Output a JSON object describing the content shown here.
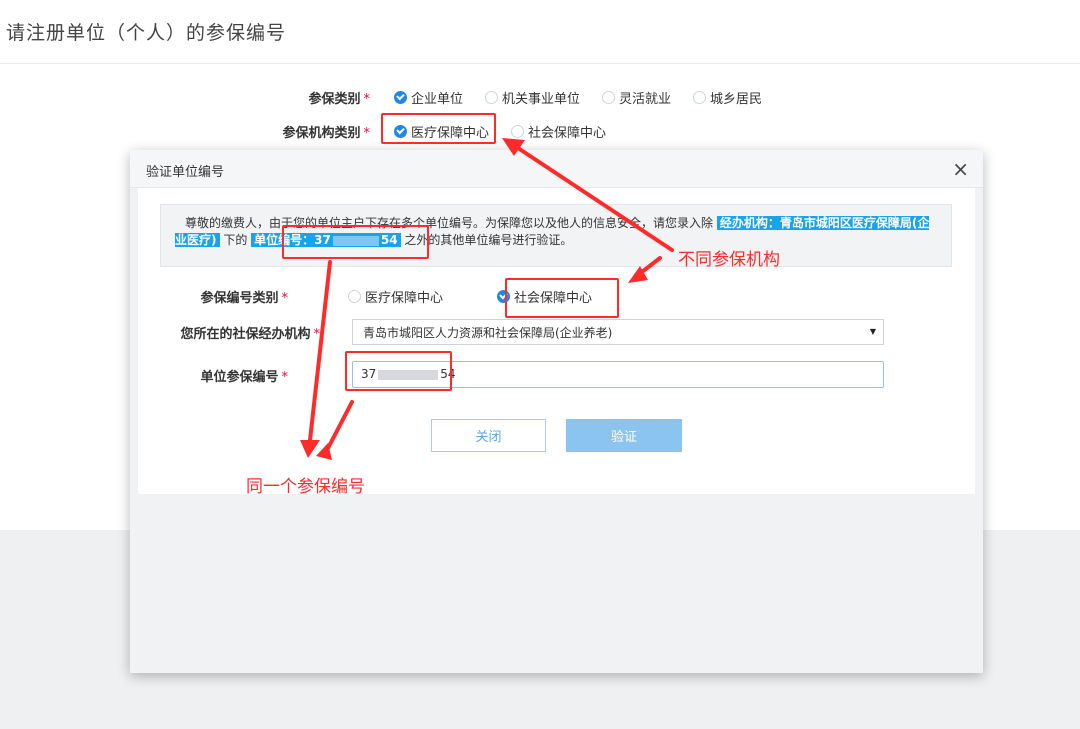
{
  "page": {
    "title": "请注册单位（个人）的参保编号"
  },
  "form": {
    "category": {
      "label": "参保类别",
      "options": [
        "企业单位",
        "机关事业单位",
        "灵活就业",
        "城乡居民"
      ],
      "selected": "企业单位"
    },
    "agency_type": {
      "label": "参保机构类别",
      "options": [
        "医疗保障中心",
        "社会保障中心"
      ],
      "selected": "医疗保障中心"
    }
  },
  "modal": {
    "title": "验证单位编号",
    "close_glyph": "×",
    "notice": {
      "part1": "尊敬的缴费人，由于您的单位主户下存在多个单位编号。为保障您以及他人的信息安全，请您录入除",
      "agency_tag": "经办机构：青岛市城阳区医疗保障局(企业医疗)",
      "mid": "下的",
      "number_tag_prefix": "单位编号：37",
      "number_tag_suffix": "54",
      "end": "之外的其他单位编号进行验证。"
    },
    "number_type": {
      "label": "参保编号类别",
      "options": [
        "医疗保障中心",
        "社会保障中心"
      ],
      "selected": "社会保障中心"
    },
    "agency_select": {
      "label": "您所在的社保经办机构",
      "value": "青岛市城阳区人力资源和社会保障局(企业养老)"
    },
    "unit_number": {
      "label": "单位参保编号",
      "value_prefix": "37",
      "value_suffix": "54"
    },
    "buttons": {
      "close": "关闭",
      "verify": "验证"
    }
  },
  "annotations": {
    "different_agency": "不同参保机构",
    "same_number": "同一个参保编号",
    "color": "#ff2a2a"
  },
  "colors": {
    "accent": "#1f87e8",
    "highlight": "#19a3ea",
    "verify_button": "#8cc4f0"
  }
}
